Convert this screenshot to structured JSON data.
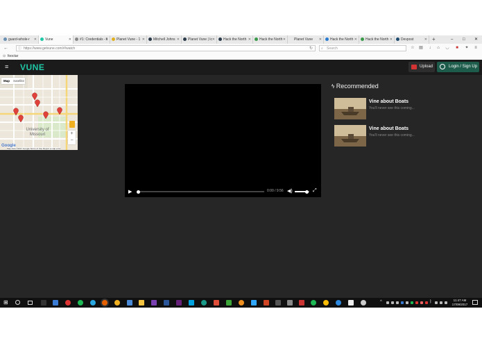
{
  "browser": {
    "tabs": [
      {
        "label": "guard-whole-r"
      },
      {
        "label": "Vune"
      },
      {
        "label": "#1: Credentials - li"
      },
      {
        "label": "Planet Vune - 1"
      },
      {
        "label": "Mitchell Johns"
      },
      {
        "label": "Planet Vune | Ic"
      },
      {
        "label": "Hack the North"
      },
      {
        "label": "Hack the North"
      },
      {
        "label": "Planet Vune"
      },
      {
        "label": "Hack the North"
      },
      {
        "label": "Hack the North"
      },
      {
        "label": "Devpost"
      }
    ],
    "new_tab_symbol": "+",
    "window_controls": {
      "minimize": "–",
      "maximize": "□",
      "close": "✕"
    },
    "url": "https://www.getvune.com/#/watch",
    "search_placeholder": "Search",
    "bookmarks": [
      "fooctar"
    ]
  },
  "app": {
    "logo": "VUNE",
    "upload_label": "Upload",
    "login_label": "Login / Sign Up",
    "map": {
      "tab_map": "Map",
      "tab_satellite": "Satellite",
      "label_university": "University of Missouri",
      "attribution": "Map data ©2017 Google   Terms of Use   Report a map error",
      "google": "Google",
      "zoom_in": "+",
      "zoom_out": "−"
    },
    "video": {
      "time": "0:00 / 9:56",
      "progress": 0.0,
      "volume": 0.8
    },
    "recommended": {
      "title": "Recommended",
      "items": [
        {
          "title": "Vine about Boats",
          "description": "You'll never see this coming..."
        },
        {
          "title": "Vine about Boats",
          "description": "You'll never see this coming..."
        }
      ]
    }
  },
  "taskbar": {
    "clock_time": "11:47 AM",
    "clock_date": "17/09/2017"
  },
  "colors": {
    "accent": "#1fc7a6",
    "app_bg": "#262626",
    "header_bg": "#1b1b1b",
    "login_bg": "#1d5c4a",
    "upload_icon": "#d33333"
  }
}
